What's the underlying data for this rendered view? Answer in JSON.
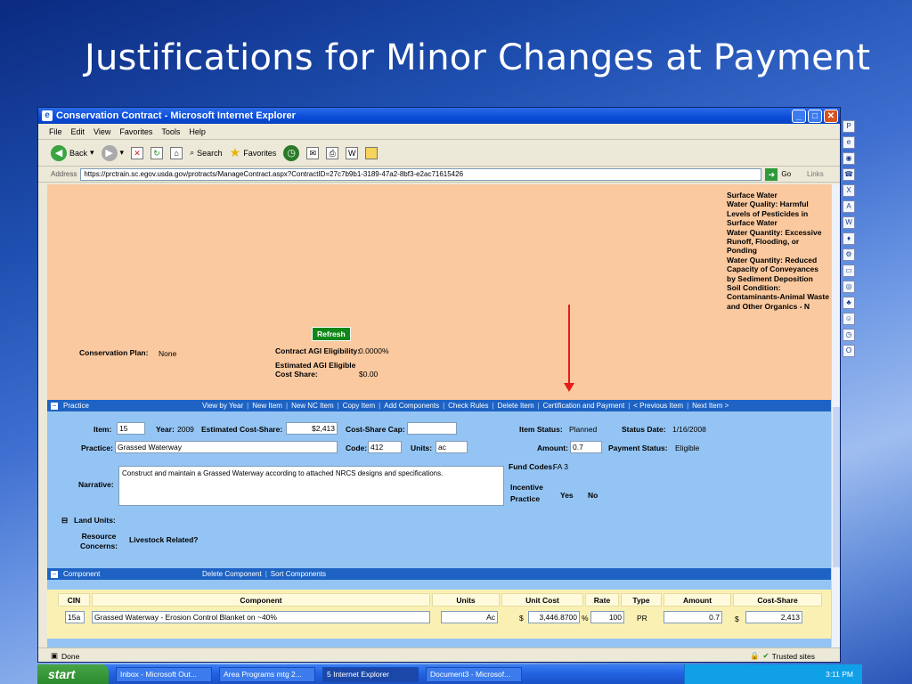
{
  "slide": {
    "title": "Justifications for Minor Changes at Payment"
  },
  "browser": {
    "title": "Conservation Contract - Microsoft Internet Explorer",
    "menu": [
      "File",
      "Edit",
      "View",
      "Favorites",
      "Tools",
      "Help"
    ],
    "toolbar": {
      "back": "Back",
      "search": "Search",
      "favorites": "Favorites"
    },
    "address_label": "Address",
    "url": "https://prctrain.sc.egov.usda.gov/protracts/ManageContract.aspx?ContractID=27c7b9b1-3189-47a2-8bf3-e2ac71615426",
    "go": "Go",
    "links": "Links",
    "status": "Done",
    "zone": "Trusted sites"
  },
  "plan": {
    "resource_concerns": "Surface Water\nWater Quality: Harmful Levels of Pesticides in Surface Water\nWater Quantity: Excessive Runoff, Flooding, or Ponding\nWater Quantity: Reduced Capacity of Conveyances by Sediment Deposition\nSoil Condition: Contaminants-Animal Waste and Other Organics - N",
    "refresh": "Refresh",
    "conservation_plan_label": "Conservation Plan:",
    "conservation_plan_value": "None",
    "agi_label": "Contract AGI Eligibility:",
    "agi_value": "0.0000%",
    "est_agi_label": "Estimated AGI Eligible Cost Share:",
    "est_agi_value": "$0.00"
  },
  "practice_bar": {
    "label": "Practice",
    "links": [
      "View by Year",
      "New Item",
      "New NC Item",
      "Copy Item",
      "Add Components",
      "Check Rules",
      "Delete Item",
      "Certification and Payment",
      "< Previous Item",
      "Next Item >"
    ]
  },
  "practice": {
    "item_label": "Item:",
    "item_value": "15",
    "year_label": "Year:",
    "year_value": "2009",
    "est_cost_label": "Estimated Cost-Share:",
    "est_cost_value": "$2,413",
    "cost_cap_label": "Cost-Share Cap:",
    "cost_cap_value": "",
    "item_status_label": "Item Status:",
    "item_status_value": "Planned",
    "status_date_label": "Status Date:",
    "status_date_value": "1/16/2008",
    "practice_label": "Practice:",
    "practice_value": "Grassed Waterway",
    "code_label": "Code:",
    "code_value": "412",
    "units_label": "Units:",
    "units_value": "ac",
    "amount_label": "Amount:",
    "amount_value": "0.7",
    "payment_status_label": "Payment Status:",
    "payment_status_value": "Eligible",
    "narrative_label": "Narrative:",
    "narrative_value": "Construct and maintain a Grassed Waterway according to attached NRCS designs and specifications.",
    "fund_codes_label": "Fund Codes:",
    "fund_codes_value": "FA 3",
    "incentive_label": "Incentive Practice",
    "yes": "Yes",
    "no": "No",
    "land_units_label": "Land Units:",
    "resource_concerns_label": "Resource Concerns:",
    "livestock_label": "Livestock Related?"
  },
  "component_bar": {
    "label": "Component",
    "links": [
      "Delete Component",
      "Sort Components"
    ]
  },
  "component": {
    "headers": {
      "cin": "CIN",
      "component": "Component",
      "units": "Units",
      "unit_cost": "Unit Cost",
      "rate": "Rate",
      "type": "Type",
      "amount": "Amount",
      "cost_share": "Cost-Share"
    },
    "row": {
      "cin": "15a",
      "component": "Grassed Waterway - Erosion Control Blanket on ~40%",
      "units": "Ac",
      "dollar": "$",
      "unit_cost": "3,446.8700",
      "pct": "%",
      "rate": "100",
      "type": "PR",
      "amount": "0.7",
      "dollar2": "$",
      "cost_share": "2,413"
    }
  },
  "taskbar": {
    "start": "start",
    "tasks": [
      "Inbox - Microsoft Out...",
      "Area Programs mtg 2...",
      "5 Internet Explorer",
      "Document3 - Microsof..."
    ],
    "clock": "3:11 PM"
  }
}
